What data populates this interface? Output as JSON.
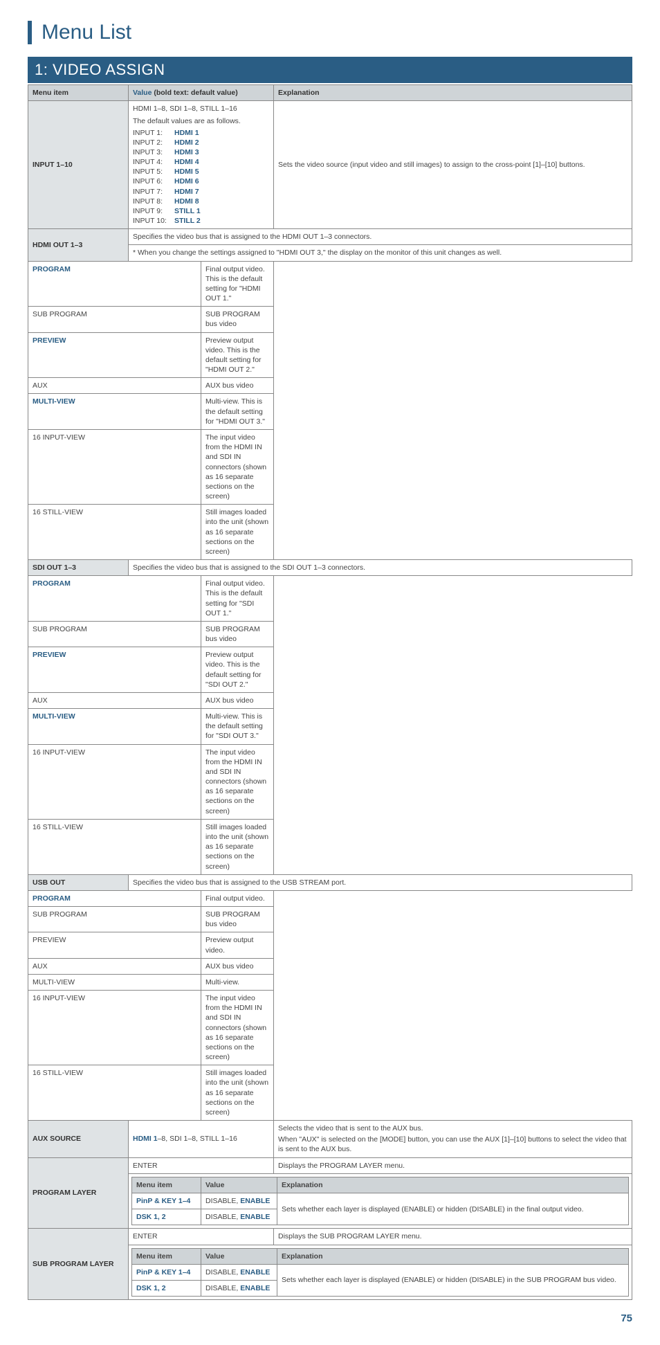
{
  "page": {
    "title": "Menu List",
    "number": "75"
  },
  "section": "1: VIDEO ASSIGN",
  "head": {
    "menu": "Menu item",
    "value": "Value",
    "value_note": " (bold text: default value)",
    "expl": "Explanation"
  },
  "input": {
    "label": "INPUT 1–10",
    "val_line1": "HDMI 1–8, SDI 1–8, STILL 1–16",
    "val_line2": "The default values are as follows.",
    "rows": [
      {
        "k": "INPUT 1:",
        "v": "HDMI 1"
      },
      {
        "k": "INPUT 2:",
        "v": "HDMI 2"
      },
      {
        "k": "INPUT 3:",
        "v": "HDMI 3"
      },
      {
        "k": "INPUT 4:",
        "v": "HDMI 4"
      },
      {
        "k": "INPUT 5:",
        "v": "HDMI 5"
      },
      {
        "k": "INPUT 6:",
        "v": "HDMI 6"
      },
      {
        "k": "INPUT 7:",
        "v": "HDMI 7"
      },
      {
        "k": "INPUT 8:",
        "v": "HDMI 8"
      },
      {
        "k": "INPUT 9:",
        "v": "STILL 1"
      },
      {
        "k": "INPUT 10:",
        "v": "STILL 2"
      }
    ],
    "expl": "Sets the video source (input video and still images) to assign to the cross-point [1]–[10] buttons."
  },
  "hdmi": {
    "label": "HDMI OUT 1–3",
    "spec": "Specifies the video bus that is assigned to the HDMI OUT 1–3 connectors.",
    "note": "* When you change the settings assigned to \"HDMI OUT 3,\" the display on the monitor of this unit changes as well.",
    "rows": [
      {
        "v": "PROGRAM",
        "bold": true,
        "e": "Final output video. This is the default setting for \"HDMI OUT 1.\""
      },
      {
        "v": "SUB PROGRAM",
        "e": "SUB PROGRAM bus video"
      },
      {
        "v": "PREVIEW",
        "bold": true,
        "e": "Preview output video. This is the default setting for \"HDMI OUT 2.\""
      },
      {
        "v": "AUX",
        "e": "AUX bus video"
      },
      {
        "v": "MULTI-VIEW",
        "bold": true,
        "e": "Multi-view. This is the default setting for \"HDMI OUT 3.\""
      },
      {
        "v": "16 INPUT-VIEW",
        "e": "The input video from the HDMI IN and SDI IN connectors (shown as 16 separate sections on the screen)"
      },
      {
        "v": "16 STILL-VIEW",
        "e": "Still images loaded into the unit (shown as 16 separate sections on the screen)"
      }
    ]
  },
  "sdi": {
    "label": "SDI OUT 1–3",
    "spec": "Specifies the video bus that is assigned to the SDI OUT 1–3 connectors.",
    "rows": [
      {
        "v": "PROGRAM",
        "bold": true,
        "e": "Final output video. This is the default setting for \"SDI OUT 1.\""
      },
      {
        "v": "SUB PROGRAM",
        "e": "SUB PROGRAM bus video"
      },
      {
        "v": "PREVIEW",
        "bold": true,
        "e": "Preview output video. This is the default setting for \"SDI OUT 2.\""
      },
      {
        "v": "AUX",
        "e": "AUX bus video"
      },
      {
        "v": "MULTI-VIEW",
        "bold": true,
        "e": "Multi-view. This is the default setting for \"SDI OUT 3.\""
      },
      {
        "v": "16 INPUT-VIEW",
        "e": "The input video from the HDMI IN and SDI IN connectors (shown as 16 separate sections on the screen)"
      },
      {
        "v": "16 STILL-VIEW",
        "e": "Still images loaded into the unit (shown as 16 separate sections on the screen)"
      }
    ]
  },
  "usb": {
    "label": "USB OUT",
    "spec": "Specifies the video bus that is assigned to the USB STREAM port.",
    "rows": [
      {
        "v": "PROGRAM",
        "bold": true,
        "e": "Final output video."
      },
      {
        "v": "SUB PROGRAM",
        "e": "SUB PROGRAM bus video"
      },
      {
        "v": "PREVIEW",
        "e": "Preview output video."
      },
      {
        "v": "AUX",
        "e": "AUX bus video"
      },
      {
        "v": "MULTI-VIEW",
        "e": "Multi-view."
      },
      {
        "v": "16 INPUT-VIEW",
        "e": "The input video from the HDMI IN and SDI IN connectors (shown as 16 separate sections on the screen)"
      },
      {
        "v": "16 STILL-VIEW",
        "e": "Still images loaded into the unit (shown as 16 separate sections on the screen)"
      }
    ]
  },
  "aux": {
    "label": "AUX SOURCE",
    "value_bold": "HDMI 1",
    "value_rest": "–8, SDI 1–8, STILL 1–16",
    "e1": "Selects the video that is sent to the AUX bus.",
    "e2": "When \"AUX\" is selected on the [MODE] button, you can use the AUX [1]–[10] buttons to select the video that is sent to the AUX bus."
  },
  "prog_layer": {
    "label": "PROGRAM LAYER",
    "enter": "ENTER",
    "enter_e": "Displays the PROGRAM LAYER menu.",
    "inner_head": {
      "m": "Menu item",
      "v": "Value",
      "e": "Explanation"
    },
    "rows": [
      {
        "m": "PinP & KEY 1–4",
        "v1": "DISABLE, ",
        "v2": "ENABLE",
        "e": "Sets whether each layer is displayed (ENABLE) or hidden (DISABLE) in the final output video."
      },
      {
        "m": "DSK 1, 2",
        "v1": "DISABLE, ",
        "v2": "ENABLE"
      }
    ]
  },
  "sub_layer": {
    "label": "SUB PROGRAM LAYER",
    "enter": "ENTER",
    "enter_e": "Displays the SUB PROGRAM LAYER menu.",
    "inner_head": {
      "m": "Menu item",
      "v": "Value",
      "e": "Explanation"
    },
    "rows": [
      {
        "m": "PinP & KEY 1–4",
        "v1": "DISABLE, ",
        "v2": "ENABLE",
        "e": "Sets whether each layer is displayed (ENABLE) or hidden (DISABLE) in the SUB PROGRAM bus video."
      },
      {
        "m": "DSK 1, 2",
        "v1": "DISABLE, ",
        "v2": "ENABLE"
      }
    ]
  }
}
